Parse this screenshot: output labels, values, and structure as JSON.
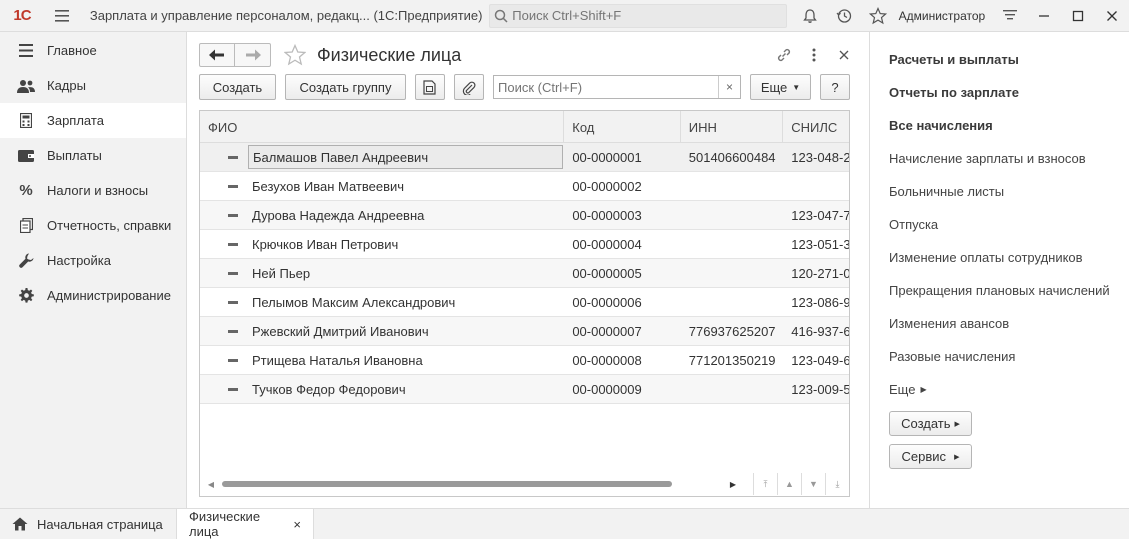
{
  "titlebar": {
    "logo": "1С",
    "app_title": "Зарплата и управление персоналом, редакц...  (1С:Предприятие)",
    "search_placeholder": "Поиск Ctrl+Shift+F",
    "user": "Администратор"
  },
  "sidebar": {
    "items": [
      {
        "label": "Главное",
        "icon": "menu-lines-icon"
      },
      {
        "label": "Кадры",
        "icon": "people-icon"
      },
      {
        "label": "Зарплата",
        "icon": "calculator-icon"
      },
      {
        "label": "Выплаты",
        "icon": "wallet-icon"
      },
      {
        "label": "Налоги и взносы",
        "icon": "percent-icon"
      },
      {
        "label": "Отчетность, справки",
        "icon": "report-icon"
      },
      {
        "label": "Настройка",
        "icon": "wrench-icon"
      },
      {
        "label": "Администрирование",
        "icon": "gear-icon"
      }
    ],
    "active_index": 2
  },
  "form": {
    "title": "Физические лица",
    "toolbar": {
      "create": "Создать",
      "create_group": "Создать группу",
      "search_placeholder": "Поиск (Ctrl+F)",
      "clear": "×",
      "more": "Еще",
      "help": "?"
    },
    "columns": [
      "ФИО",
      "Код",
      "ИНН",
      "СНИЛС"
    ],
    "rows": [
      {
        "fio": "Балмашов Павел Андреевич",
        "code": "00-0000001",
        "inn": "501406600484",
        "snils": "123-048-2"
      },
      {
        "fio": "Безухов Иван Матвеевич",
        "code": "00-0000002",
        "inn": "",
        "snils": ""
      },
      {
        "fio": "Дурова Надежда Андреевна",
        "code": "00-0000003",
        "inn": "",
        "snils": "123-047-7"
      },
      {
        "fio": "Крючков Иван Петрович",
        "code": "00-0000004",
        "inn": "",
        "snils": "123-051-3"
      },
      {
        "fio": "Ней Пьер",
        "code": "00-0000005",
        "inn": "",
        "snils": "120-271-0"
      },
      {
        "fio": "Пелымов Максим Александрович",
        "code": "00-0000006",
        "inn": "",
        "snils": "123-086-9"
      },
      {
        "fio": "Ржевский Дмитрий Иванович",
        "code": "00-0000007",
        "inn": "776937625207",
        "snils": "416-937-6"
      },
      {
        "fio": "Ртищева Наталья Ивановна",
        "code": "00-0000008",
        "inn": "771201350219",
        "snils": "123-049-6"
      },
      {
        "fio": "Тучков Федор Федорович",
        "code": "00-0000009",
        "inn": "",
        "snils": "123-009-5"
      }
    ]
  },
  "rpanel": {
    "bold_links": [
      "Расчеты и выплаты",
      "Отчеты по зарплате",
      "Все начисления"
    ],
    "links": [
      "Начисление зарплаты и взносов",
      "Больничные листы",
      "Отпуска",
      "Изменение оплаты сотрудников",
      "Прекращения плановых начислений",
      "Изменения авансов",
      "Разовые начисления"
    ],
    "more": "Еще",
    "create_btn": "Создать",
    "service_btn": "Сервис"
  },
  "bottom_tabs": {
    "home": "Начальная страница",
    "active": "Физические лица",
    "close": "×"
  },
  "colors": {
    "logo": "#c0392b",
    "panel_bg": "#f2f2f2",
    "active_bg": "#ffffff"
  }
}
